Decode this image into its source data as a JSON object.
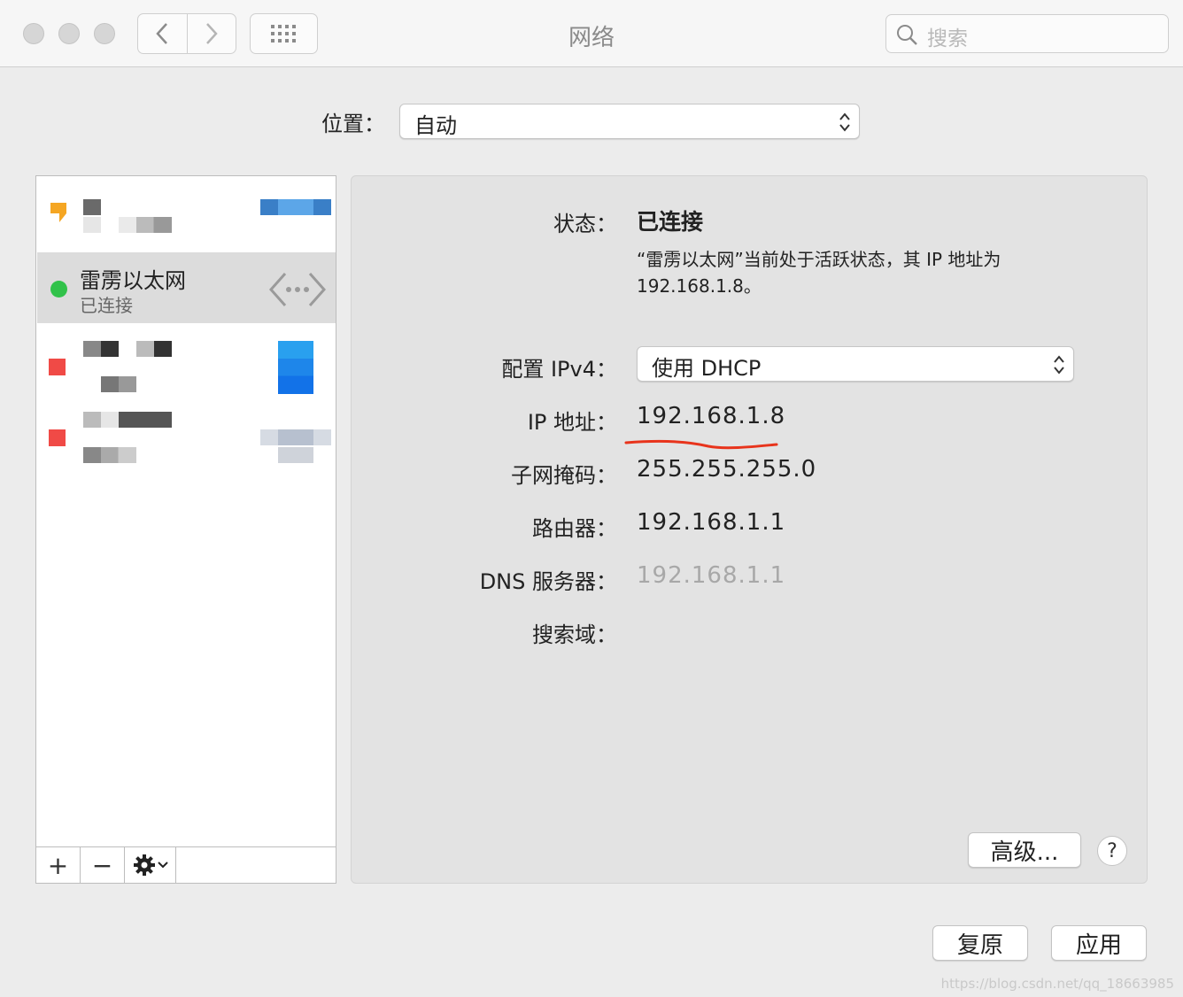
{
  "window": {
    "title": "网络"
  },
  "toolbar": {
    "back_label": "<",
    "forward_label": ">",
    "search_placeholder": "搜索"
  },
  "location": {
    "label": "位置：",
    "value": "自动"
  },
  "sidebar": {
    "selected_service": {
      "name": "雷雳以太网",
      "status": "已连接",
      "status_color": "#31c24a"
    },
    "other_status_colors": [
      "#f5a623",
      "#f04a46",
      "#f04a46"
    ],
    "tools": {
      "add": "+",
      "remove": "−"
    }
  },
  "detail": {
    "status_label": "状态：",
    "status_value": "已连接",
    "status_description_line1": "“雷雳以太网”当前处于活跃状态，其 IP 地址为",
    "status_description_line2": "192.168.1.8。",
    "config_label": "配置 IPv4：",
    "config_value": "使用 DHCP",
    "ip_label": "IP 地址：",
    "ip_value": "192.168.1.8",
    "subnet_label": "子网掩码：",
    "subnet_value": "255.255.255.0",
    "router_label": "路由器：",
    "router_value": "192.168.1.1",
    "dns_label": "DNS 服务器：",
    "dns_value": "192.168.1.1",
    "search_domain_label": "搜索域：",
    "advanced_button": "高级...",
    "help_button": "?"
  },
  "footer": {
    "revert_button": "复原",
    "apply_button": "应用",
    "watermark": "https://blog.csdn.net/qq_18663985"
  },
  "colors": {
    "annotation_underline": "#e8341c",
    "dns_value_color": "#a8a8a8"
  }
}
